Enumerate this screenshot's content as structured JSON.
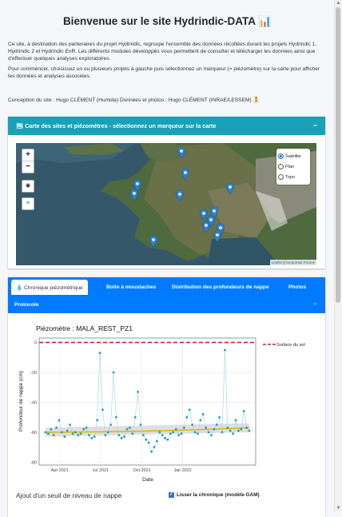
{
  "header": {
    "title": "Bienvenue sur le site Hydrindic-DATA 📊"
  },
  "intro": {
    "p1": "Ce site, à destination des partenaires du projet Hydrindic, regroupe l'ensemble des données récoltées durant les projets Hydrindic 1, Hydrindic 2 et Hydrindic EnR. Les différents modules développés vous permettent de consulter et télécharger les données ainsi que d'effectuer quelques analyses exploratoires.",
    "p2": "Pour commencer, choisissez un ou plusieurs projets à gauche puis sélectionnez un marqueur (= piézomètre) sur la carte pour afficher les données et analyses associées."
  },
  "credits": "Conception du site : Hugo CLÉMENT (Humida)   Données et photos : Hugo CLÉMENT (INRAE/LESSEM) 🧘",
  "map_card": {
    "title": "🗺 Carte des sites et piézomètres - sélectionnez un marqueur sur la carte",
    "collapse": "−",
    "zoom_in": "+",
    "zoom_out": "−",
    "layers": [
      "Satellite",
      "Plan",
      "Topo"
    ],
    "selected_layer": "Satellite",
    "attribution_leaflet": "Leaflet",
    "attribution_sep": " | ",
    "attribution_src": "Geoportail France"
  },
  "tabs_card": {
    "tabs": [
      "💧 Chronique piézométrique",
      "Boîte à moustaches",
      "Distribution des profondeurs de nappe",
      "Photos",
      "Protocole"
    ],
    "active_tab": "Chronique piézométrique",
    "collapse": "−",
    "threshold_label": "Ajout d'un seuil de niveau de nappe",
    "smooth_label": "Lisser la chronique (modèle GAM)",
    "smooth_checked": true
  },
  "chart_data": {
    "type": "line",
    "title": "Piézomètre : MALA_REST_PZ1",
    "xlabel": "Date",
    "ylabel": "Profondeur de nappe (cm)",
    "ylim": [
      -82,
      3
    ],
    "yticks": [
      0,
      -20,
      -40,
      -60,
      -80
    ],
    "xticks": [
      "Apr 2021",
      "Jul 2021",
      "Oct 2021",
      "Jan 2022"
    ],
    "legend": {
      "label": "Surface du sol",
      "placement": "right"
    },
    "surface_line": 0,
    "colors": {
      "series": "#1f9bc7",
      "smooth": "#e0b400",
      "smooth_ci": "#c9c9c9",
      "surface": "#c0282d"
    },
    "series": {
      "x_month_index": [
        0.0,
        0.2,
        0.4,
        0.6,
        0.8,
        1.0,
        1.2,
        1.4,
        1.6,
        1.8,
        2.0,
        2.2,
        2.4,
        2.6,
        2.8,
        3.0,
        3.2,
        3.4,
        3.6,
        3.8,
        4.0,
        4.2,
        4.4,
        4.6,
        4.8,
        5.0,
        5.2,
        5.4,
        5.6,
        5.8,
        6.0,
        6.2,
        6.4,
        6.6,
        6.8,
        7.0,
        7.2,
        7.4,
        7.6,
        7.8,
        8.0,
        8.2,
        8.4,
        8.6,
        8.8,
        9.0,
        9.2,
        9.4,
        9.6,
        9.8,
        10.0,
        10.2,
        10.4,
        10.6,
        10.8,
        11.0,
        11.2,
        11.4,
        11.6,
        11.8,
        12.0,
        12.2,
        12.4,
        12.6,
        12.8,
        13.0,
        13.2,
        13.4,
        13.6,
        13.8,
        14.0,
        14.2,
        14.4,
        14.6,
        14.8,
        15.0
      ],
      "y": [
        -60,
        -61,
        -58,
        -62,
        -57,
        -52,
        -60,
        -63,
        -59,
        -55,
        -61,
        -60,
        -62,
        -61,
        -58,
        -57,
        -62,
        -64,
        -63,
        -52,
        -7,
        -45,
        -62,
        -60,
        -55,
        -20,
        -50,
        -62,
        -64,
        -63,
        -58,
        -57,
        -61,
        -50,
        -33,
        -55,
        -62,
        -65,
        -67,
        -73,
        -70,
        -66,
        -60,
        -62,
        -64,
        -65,
        -61,
        -60,
        -58,
        -62,
        -61,
        -57,
        -50,
        -45,
        -55,
        -60,
        -61,
        -52,
        -48,
        -57,
        -60,
        -62,
        -58,
        -55,
        -50,
        -60,
        -5,
        -57,
        -59,
        -61,
        -52,
        -59,
        -58,
        -46,
        -57,
        -59
      ]
    },
    "smooth": {
      "start": -60,
      "end": -57
    }
  }
}
